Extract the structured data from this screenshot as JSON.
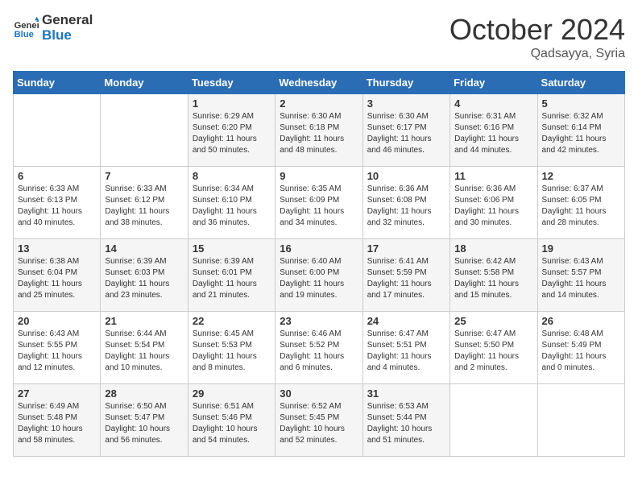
{
  "logo": {
    "text_general": "General",
    "text_blue": "Blue"
  },
  "title": "October 2024",
  "subtitle": "Qadsayya, Syria",
  "days_of_week": [
    "Sunday",
    "Monday",
    "Tuesday",
    "Wednesday",
    "Thursday",
    "Friday",
    "Saturday"
  ],
  "weeks": [
    [
      {
        "day": "",
        "sunrise": "",
        "sunset": "",
        "daylight": ""
      },
      {
        "day": "",
        "sunrise": "",
        "sunset": "",
        "daylight": ""
      },
      {
        "day": "1",
        "sunrise": "Sunrise: 6:29 AM",
        "sunset": "Sunset: 6:20 PM",
        "daylight": "Daylight: 11 hours and 50 minutes."
      },
      {
        "day": "2",
        "sunrise": "Sunrise: 6:30 AM",
        "sunset": "Sunset: 6:18 PM",
        "daylight": "Daylight: 11 hours and 48 minutes."
      },
      {
        "day": "3",
        "sunrise": "Sunrise: 6:30 AM",
        "sunset": "Sunset: 6:17 PM",
        "daylight": "Daylight: 11 hours and 46 minutes."
      },
      {
        "day": "4",
        "sunrise": "Sunrise: 6:31 AM",
        "sunset": "Sunset: 6:16 PM",
        "daylight": "Daylight: 11 hours and 44 minutes."
      },
      {
        "day": "5",
        "sunrise": "Sunrise: 6:32 AM",
        "sunset": "Sunset: 6:14 PM",
        "daylight": "Daylight: 11 hours and 42 minutes."
      }
    ],
    [
      {
        "day": "6",
        "sunrise": "Sunrise: 6:33 AM",
        "sunset": "Sunset: 6:13 PM",
        "daylight": "Daylight: 11 hours and 40 minutes."
      },
      {
        "day": "7",
        "sunrise": "Sunrise: 6:33 AM",
        "sunset": "Sunset: 6:12 PM",
        "daylight": "Daylight: 11 hours and 38 minutes."
      },
      {
        "day": "8",
        "sunrise": "Sunrise: 6:34 AM",
        "sunset": "Sunset: 6:10 PM",
        "daylight": "Daylight: 11 hours and 36 minutes."
      },
      {
        "day": "9",
        "sunrise": "Sunrise: 6:35 AM",
        "sunset": "Sunset: 6:09 PM",
        "daylight": "Daylight: 11 hours and 34 minutes."
      },
      {
        "day": "10",
        "sunrise": "Sunrise: 6:36 AM",
        "sunset": "Sunset: 6:08 PM",
        "daylight": "Daylight: 11 hours and 32 minutes."
      },
      {
        "day": "11",
        "sunrise": "Sunrise: 6:36 AM",
        "sunset": "Sunset: 6:06 PM",
        "daylight": "Daylight: 11 hours and 30 minutes."
      },
      {
        "day": "12",
        "sunrise": "Sunrise: 6:37 AM",
        "sunset": "Sunset: 6:05 PM",
        "daylight": "Daylight: 11 hours and 28 minutes."
      }
    ],
    [
      {
        "day": "13",
        "sunrise": "Sunrise: 6:38 AM",
        "sunset": "Sunset: 6:04 PM",
        "daylight": "Daylight: 11 hours and 25 minutes."
      },
      {
        "day": "14",
        "sunrise": "Sunrise: 6:39 AM",
        "sunset": "Sunset: 6:03 PM",
        "daylight": "Daylight: 11 hours and 23 minutes."
      },
      {
        "day": "15",
        "sunrise": "Sunrise: 6:39 AM",
        "sunset": "Sunset: 6:01 PM",
        "daylight": "Daylight: 11 hours and 21 minutes."
      },
      {
        "day": "16",
        "sunrise": "Sunrise: 6:40 AM",
        "sunset": "Sunset: 6:00 PM",
        "daylight": "Daylight: 11 hours and 19 minutes."
      },
      {
        "day": "17",
        "sunrise": "Sunrise: 6:41 AM",
        "sunset": "Sunset: 5:59 PM",
        "daylight": "Daylight: 11 hours and 17 minutes."
      },
      {
        "day": "18",
        "sunrise": "Sunrise: 6:42 AM",
        "sunset": "Sunset: 5:58 PM",
        "daylight": "Daylight: 11 hours and 15 minutes."
      },
      {
        "day": "19",
        "sunrise": "Sunrise: 6:43 AM",
        "sunset": "Sunset: 5:57 PM",
        "daylight": "Daylight: 11 hours and 14 minutes."
      }
    ],
    [
      {
        "day": "20",
        "sunrise": "Sunrise: 6:43 AM",
        "sunset": "Sunset: 5:55 PM",
        "daylight": "Daylight: 11 hours and 12 minutes."
      },
      {
        "day": "21",
        "sunrise": "Sunrise: 6:44 AM",
        "sunset": "Sunset: 5:54 PM",
        "daylight": "Daylight: 11 hours and 10 minutes."
      },
      {
        "day": "22",
        "sunrise": "Sunrise: 6:45 AM",
        "sunset": "Sunset: 5:53 PM",
        "daylight": "Daylight: 11 hours and 8 minutes."
      },
      {
        "day": "23",
        "sunrise": "Sunrise: 6:46 AM",
        "sunset": "Sunset: 5:52 PM",
        "daylight": "Daylight: 11 hours and 6 minutes."
      },
      {
        "day": "24",
        "sunrise": "Sunrise: 6:47 AM",
        "sunset": "Sunset: 5:51 PM",
        "daylight": "Daylight: 11 hours and 4 minutes."
      },
      {
        "day": "25",
        "sunrise": "Sunrise: 6:47 AM",
        "sunset": "Sunset: 5:50 PM",
        "daylight": "Daylight: 11 hours and 2 minutes."
      },
      {
        "day": "26",
        "sunrise": "Sunrise: 6:48 AM",
        "sunset": "Sunset: 5:49 PM",
        "daylight": "Daylight: 11 hours and 0 minutes."
      }
    ],
    [
      {
        "day": "27",
        "sunrise": "Sunrise: 6:49 AM",
        "sunset": "Sunset: 5:48 PM",
        "daylight": "Daylight: 10 hours and 58 minutes."
      },
      {
        "day": "28",
        "sunrise": "Sunrise: 6:50 AM",
        "sunset": "Sunset: 5:47 PM",
        "daylight": "Daylight: 10 hours and 56 minutes."
      },
      {
        "day": "29",
        "sunrise": "Sunrise: 6:51 AM",
        "sunset": "Sunset: 5:46 PM",
        "daylight": "Daylight: 10 hours and 54 minutes."
      },
      {
        "day": "30",
        "sunrise": "Sunrise: 6:52 AM",
        "sunset": "Sunset: 5:45 PM",
        "daylight": "Daylight: 10 hours and 52 minutes."
      },
      {
        "day": "31",
        "sunrise": "Sunrise: 6:53 AM",
        "sunset": "Sunset: 5:44 PM",
        "daylight": "Daylight: 10 hours and 51 minutes."
      },
      {
        "day": "",
        "sunrise": "",
        "sunset": "",
        "daylight": ""
      },
      {
        "day": "",
        "sunrise": "",
        "sunset": "",
        "daylight": ""
      }
    ]
  ]
}
